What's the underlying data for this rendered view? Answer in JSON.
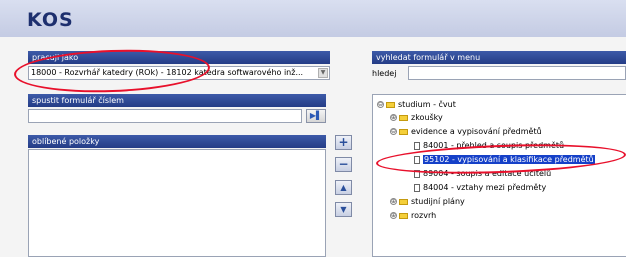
{
  "app": {
    "logo": "KOS"
  },
  "role_panel": {
    "header": "pracuji jako",
    "selected_value": "18000 - Rozvrhář katedry (ROk) - 18102 katedra softwarového inž..."
  },
  "form_number_panel": {
    "header": "spustit formulář číslem",
    "go_icon": "play-forward-icon"
  },
  "favorites_panel": {
    "header": "oblíbené položky"
  },
  "side_buttons": {
    "add": "+",
    "remove": "−",
    "up": "▲",
    "down": "▼"
  },
  "menu_search_panel": {
    "header": "vyhledat formulář v menu",
    "search_label": "hledej"
  },
  "tree": {
    "root": {
      "label": "studium - čvut",
      "expander": "⊖"
    },
    "zkousky": {
      "label": "zkoušky",
      "expander": "⊕"
    },
    "evidence": {
      "label": "evidence a vypisování předmětů",
      "expander": "⊖"
    },
    "f84001": {
      "label": "84001 - přehled a soupis předmětů"
    },
    "f95102": {
      "label": "95102 - vypisování a klasifikace předmětů"
    },
    "f89004": {
      "label": "89004 - soupis a editace učitelů"
    },
    "f84004": {
      "label": "84004 - vztahy mezi předměty"
    },
    "plany": {
      "label": "studijní plány",
      "expander": "⊕"
    },
    "rozvrh": {
      "label": "rozvrh",
      "expander": "⊕"
    }
  },
  "colors": {
    "header_blue": "#243c86",
    "selection": "#1540c8",
    "annotation_red": "#e8102b"
  }
}
